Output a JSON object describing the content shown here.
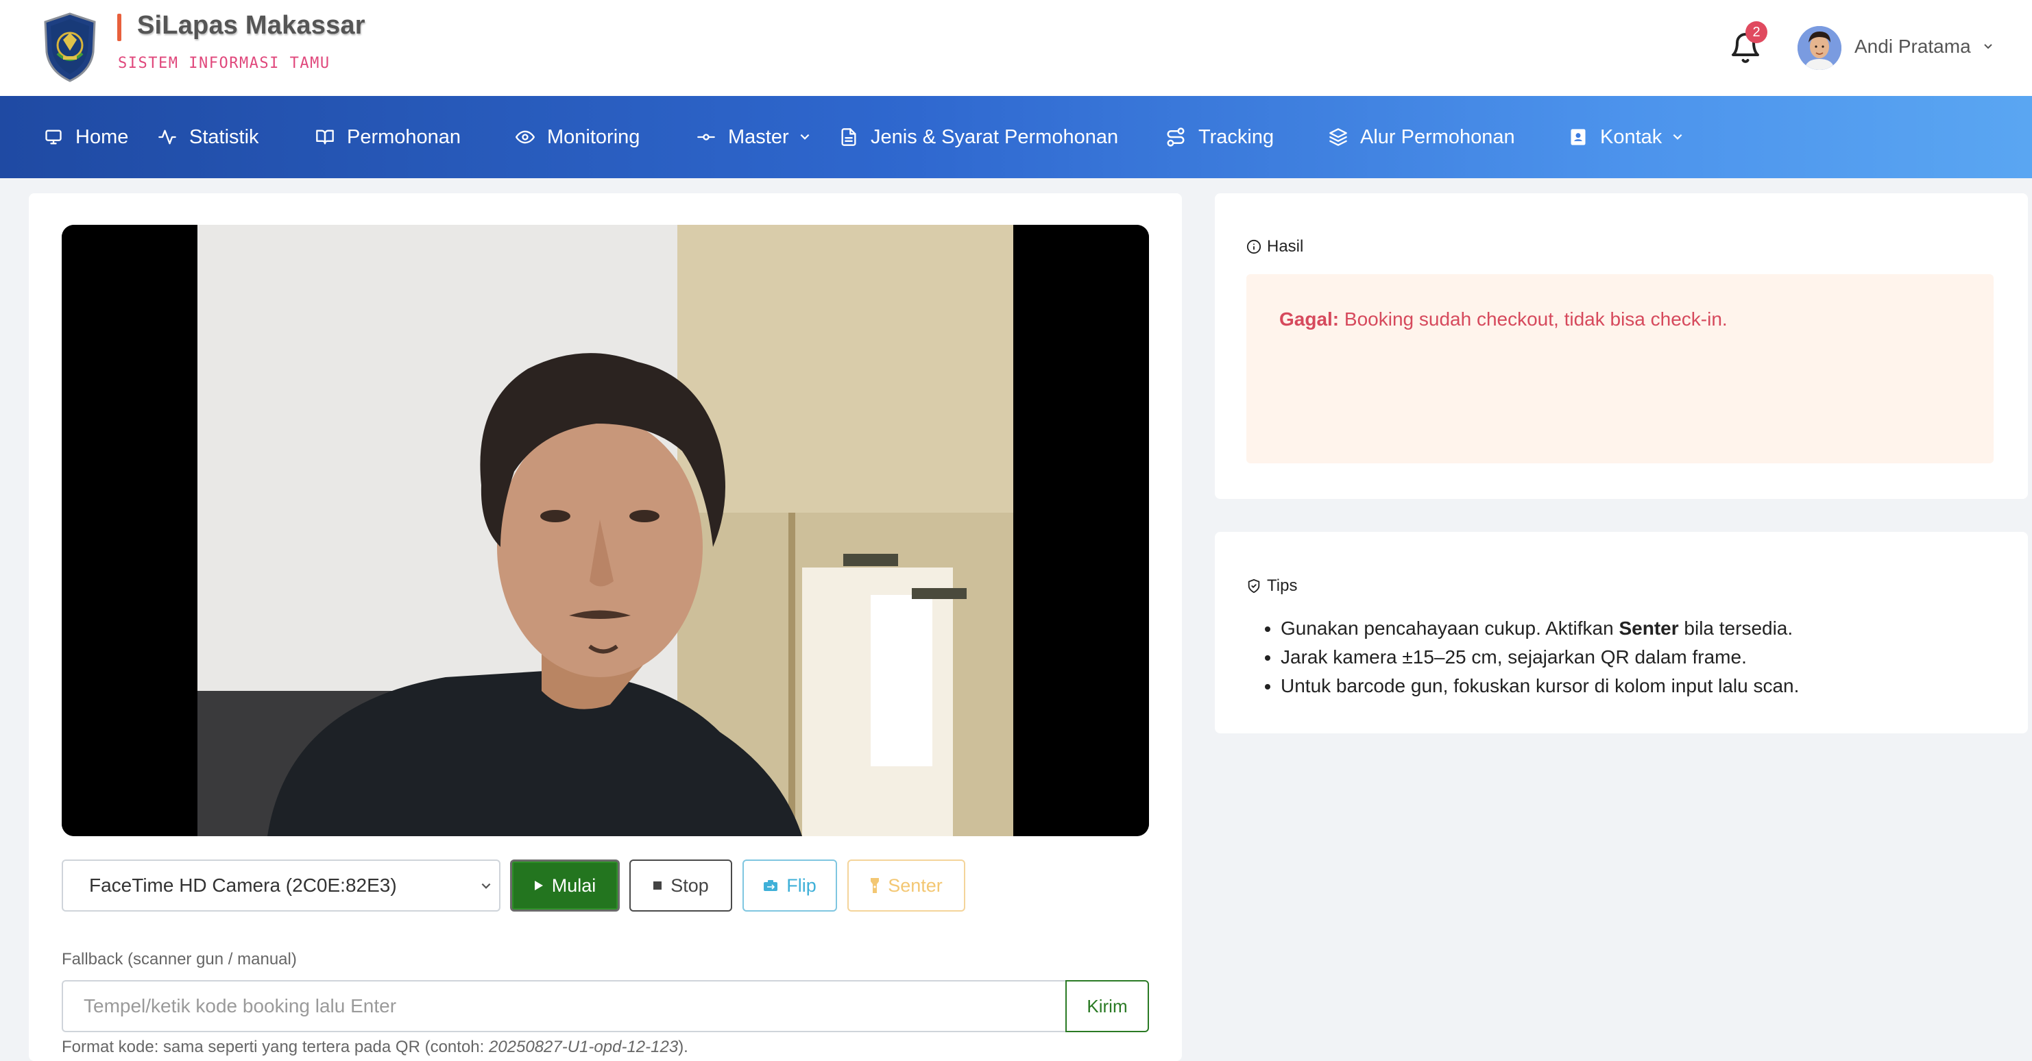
{
  "header": {
    "app_title": "SiLapas Makassar",
    "app_subtitle": "SISTEM INFORMASI TAMU",
    "notification_count": "2",
    "user_name": "Andi Pratama"
  },
  "nav": {
    "items": [
      {
        "label": "Home",
        "icon": "monitor-icon"
      },
      {
        "label": "Statistik",
        "icon": "activity-icon"
      },
      {
        "label": "Permohonan",
        "icon": "book-open-icon"
      },
      {
        "label": "Monitoring",
        "icon": "eye-icon"
      },
      {
        "label": "Master",
        "icon": "git-commit-icon"
      },
      {
        "label": "Jenis & Syarat Permohonan",
        "icon": "file-text-icon"
      },
      {
        "label": "Tracking",
        "icon": "route-icon"
      },
      {
        "label": "Alur Permohonan",
        "icon": "layers-icon"
      },
      {
        "label": "Kontak",
        "icon": "contact-book-icon"
      }
    ]
  },
  "scanner": {
    "camera_selected": "FaceTime HD Camera (2C0E:82E3)",
    "btn_start": "Mulai",
    "btn_stop": "Stop",
    "btn_flip": "Flip",
    "btn_torch": "Senter",
    "fallback_label": "Fallback (scanner gun / manual)",
    "input_placeholder": "Tempel/ketik kode booking lalu Enter",
    "btn_send": "Kirim",
    "format_note_prefix": "Format kode: sama seperti yang tertera pada QR (contoh: ",
    "format_note_example": "20250827-U1-opd-12-123",
    "format_note_suffix": ")."
  },
  "result": {
    "heading": "Hasil",
    "status_label": "Gagal:",
    "message": "Booking sudah checkout, tidak bisa check-in."
  },
  "tips": {
    "heading": "Tips",
    "item1_a": "Gunakan pencahayaan cukup. Aktifkan ",
    "item1_b": "Senter",
    "item1_c": " bila tersedia.",
    "item2": "Jarak kamera ±15–25 cm, sejajarkan QR dalam frame.",
    "item3": "Untuk barcode gun, fokuskan kursor di kolom input lalu scan."
  },
  "colors": {
    "nav_gradient_start": "#1f4aa3",
    "nav_gradient_end": "#5aa6f2",
    "start_button": "#23751f",
    "error_text": "#d6495c",
    "alert_bg": "#fff4ec",
    "subtitle": "#e0487c"
  }
}
